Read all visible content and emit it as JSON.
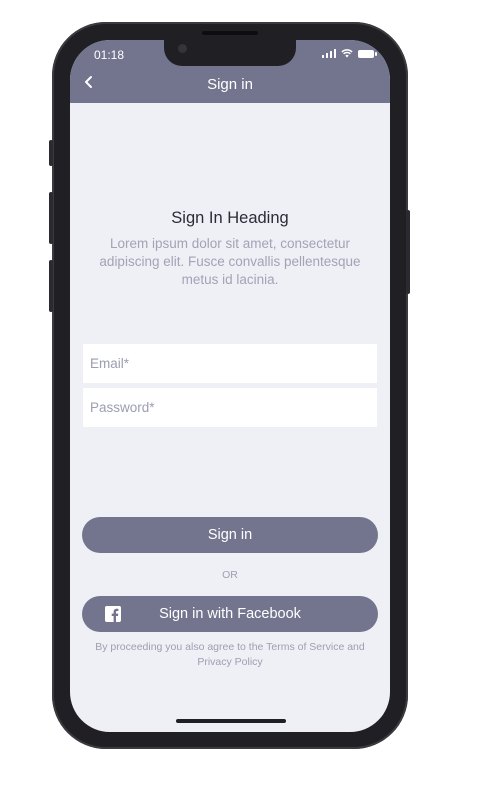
{
  "status_bar": {
    "time": "01:18"
  },
  "nav": {
    "title": "Sign in",
    "back_icon": "chevron-left-icon"
  },
  "content": {
    "heading": "Sign In Heading",
    "subtext": "Lorem ipsum dolor sit amet, consectetur adipiscing elit. Fusce convallis pellentesque metus id lacinia."
  },
  "form": {
    "email_placeholder": "Email*",
    "password_placeholder": "Password*"
  },
  "actions": {
    "sign_in_label": "Sign in",
    "or_label": "OR",
    "facebook_label": "Sign in with Facebook",
    "facebook_icon": "facebook-icon"
  },
  "terms_text": "By proceeding you also agree to the Terms of Service and Privacy Policy",
  "colors": {
    "accent": "#73758f",
    "screen_bg": "#efeff6",
    "heading": "#2b2c36",
    "muted": "#a2a3b5"
  }
}
